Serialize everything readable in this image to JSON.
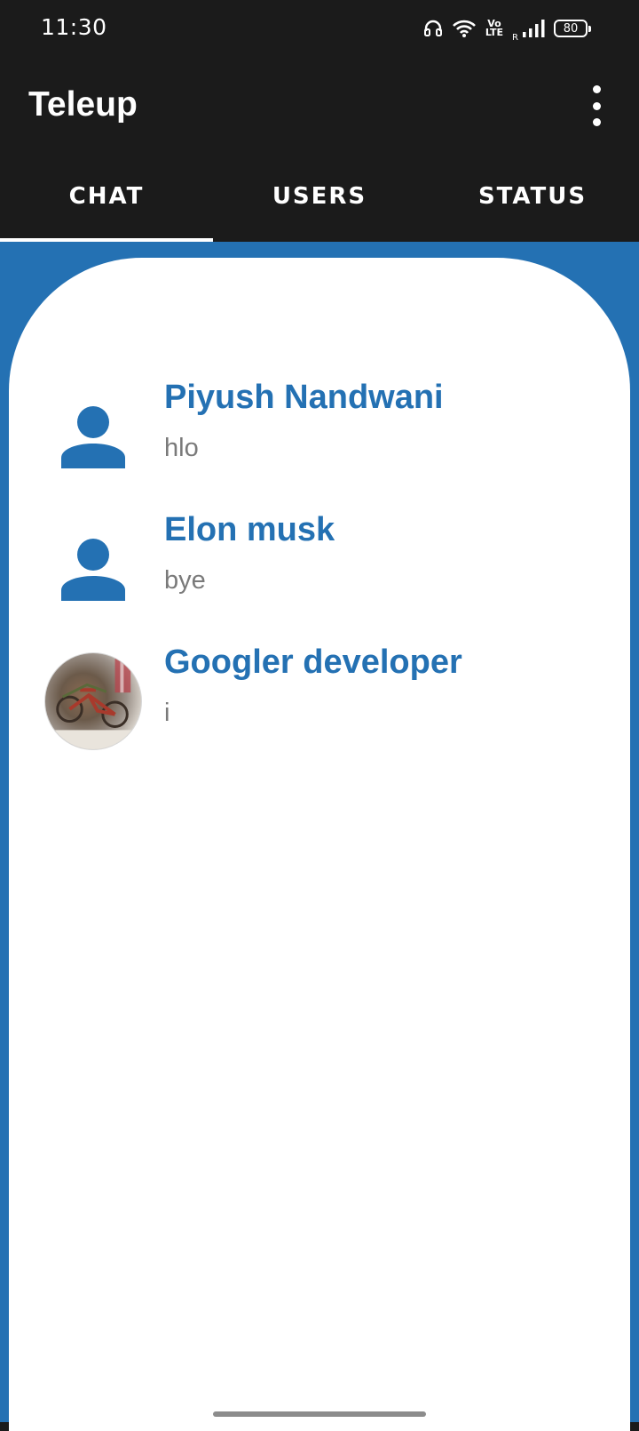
{
  "status_bar": {
    "time": "11:30",
    "volte_top": "Vo",
    "volte_bottom": "LTE",
    "signal_label": "R",
    "battery": "80"
  },
  "app_bar": {
    "title": "Teleup"
  },
  "tabs": [
    {
      "label": "CHAT",
      "active": true
    },
    {
      "label": "USERS",
      "active": false
    },
    {
      "label": "STATUS",
      "active": false
    }
  ],
  "chats": [
    {
      "name": "Piyush Nandwani",
      "last_message": "hlo",
      "avatar": "default-person-icon"
    },
    {
      "name": "Elon musk",
      "last_message": "bye",
      "avatar": "default-person-icon"
    },
    {
      "name": "Googler developer",
      "last_message": "i",
      "avatar": "profile-photo"
    }
  ],
  "colors": {
    "accent": "#2471b3",
    "bar_background": "#1b1b1b",
    "message_text": "#7a7a7a"
  }
}
